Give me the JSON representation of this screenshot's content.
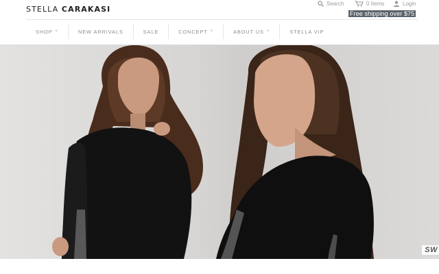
{
  "brand": {
    "name_light": "STELLA",
    "name_bold": "CARAKASI"
  },
  "utility": {
    "search_label": "Search",
    "cart_label": "0 Items",
    "login_label": "Login",
    "icons": [
      "search-icon",
      "cart-icon",
      "user-icon"
    ]
  },
  "promo": {
    "text": "Free shipping over $75",
    "bg": "#5a636a"
  },
  "nav": {
    "items": [
      {
        "label": "SHOP",
        "has_dropdown": true
      },
      {
        "label": "NEW ARRIVALS",
        "has_dropdown": false
      },
      {
        "label": "SALE",
        "has_dropdown": false
      },
      {
        "label": "CONCEPT",
        "has_dropdown": true
      },
      {
        "label": "ABOUT US",
        "has_dropdown": true
      },
      {
        "label": "STELLA VIP",
        "has_dropdown": false
      }
    ],
    "caret": "˅"
  },
  "hero": {
    "tag": "SW"
  }
}
